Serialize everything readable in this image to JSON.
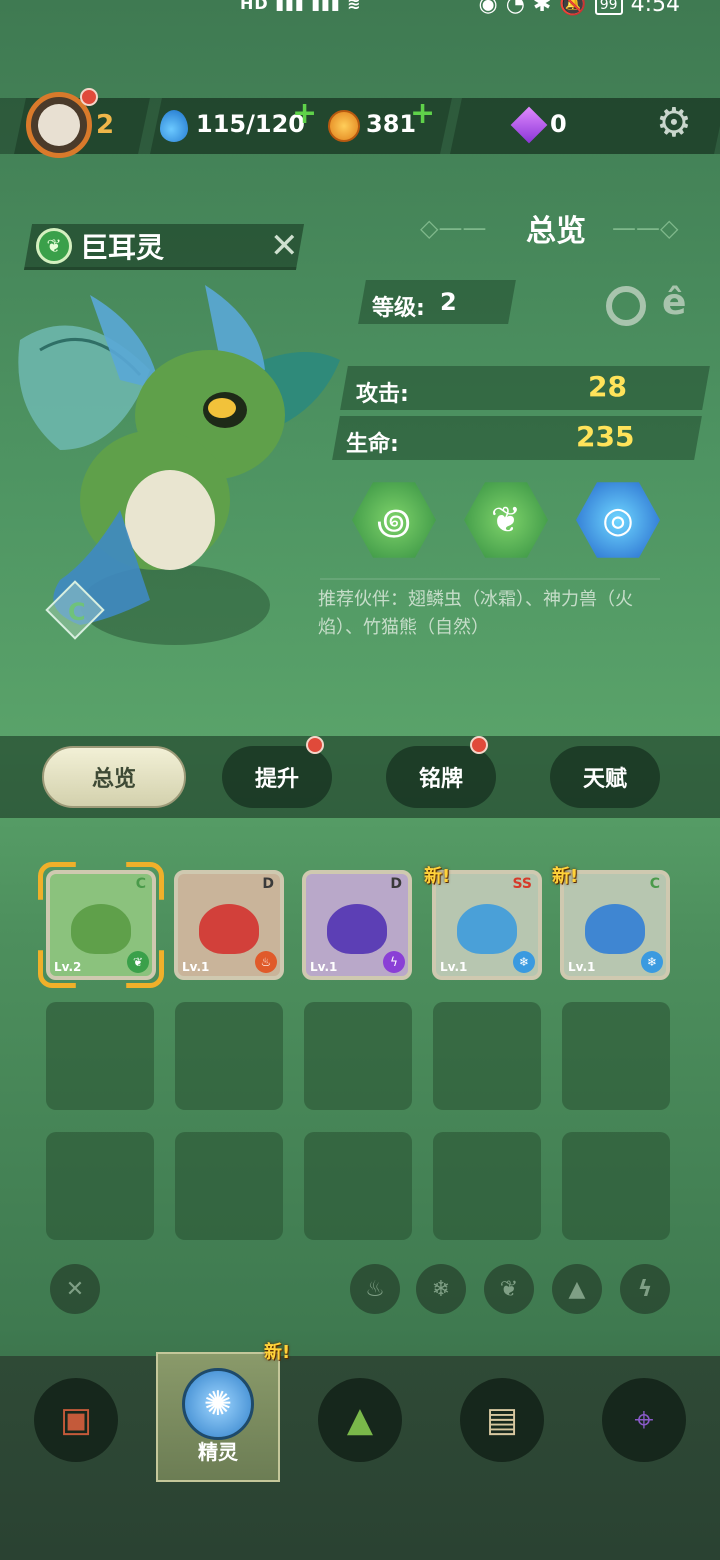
{
  "status_bar": {
    "left_text": "HD ",
    "time": "4:54",
    "battery": "99"
  },
  "resources": {
    "level": "2",
    "energy": "115/120",
    "coins": "381",
    "gems": "0"
  },
  "pet": {
    "name": "巨耳灵",
    "rank": "C"
  },
  "overview": {
    "title": "总览",
    "level_label": "等级:",
    "level_value": "2",
    "attack_label": "攻击:",
    "attack_value": "28",
    "hp_label": "生命:",
    "hp_value": "235",
    "recommend_text": "推荐伙伴：翅鳞虫（冰霜）、神力兽（火焰）、竹猫熊（自然）"
  },
  "tabs": [
    {
      "label": "总览",
      "active": true,
      "dot": false
    },
    {
      "label": "提升",
      "active": false,
      "dot": true
    },
    {
      "label": "铭牌",
      "active": false,
      "dot": true
    },
    {
      "label": "天赋",
      "active": false,
      "dot": false
    }
  ],
  "cards": [
    {
      "level": "Lv.2",
      "rank": "C",
      "element": "nature",
      "new": false,
      "color": "#6fb06a"
    },
    {
      "level": "Lv.1",
      "rank": "D",
      "element": "fire",
      "new": false,
      "color": "#d2403a"
    },
    {
      "level": "Lv.1",
      "rank": "D",
      "element": "thunder",
      "new": false,
      "color": "#5c3fb5"
    },
    {
      "level": "Lv.1",
      "rank": "SS",
      "element": "ice",
      "new": true,
      "color": "#4aa0d8"
    },
    {
      "level": "Lv.1",
      "rank": "C",
      "element": "ice",
      "new": true,
      "color": "#3f86d2"
    }
  ],
  "new_label": "新!",
  "bottom_nav": {
    "active_label": "精灵",
    "new_label": "新!"
  },
  "colors": {
    "accent_yellow": "#ffe35a",
    "red_dot": "#e04a3a"
  }
}
